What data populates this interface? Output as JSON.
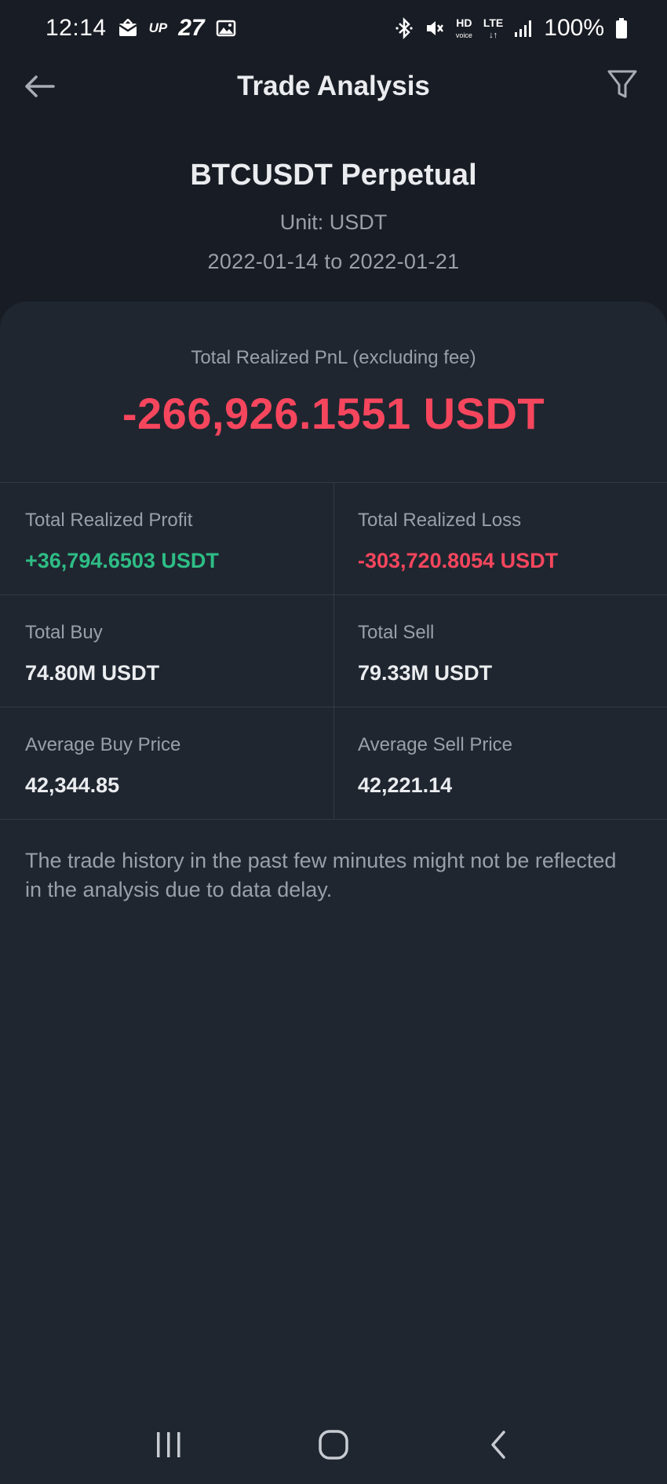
{
  "status_bar": {
    "time": "12:14",
    "up_label": "UP",
    "up_number": "27",
    "hd_label": "HD",
    "hd_sub": "voice",
    "lte_label": "LTE",
    "battery": "100%"
  },
  "header": {
    "title": "Trade Analysis",
    "symbol": "BTCUSDT Perpetual",
    "unit": "Unit: USDT",
    "date_range": "2022-01-14 to 2022-01-21"
  },
  "summary": {
    "pnl_label": "Total Realized PnL (excluding fee)",
    "pnl_value": "-266,926.1551 USDT"
  },
  "stats": [
    {
      "left_label": "Total Realized Profit",
      "left_value": "+36,794.6503 USDT",
      "right_label": "Total Realized Loss",
      "right_value": "-303,720.8054 USDT"
    },
    {
      "left_label": "Total Buy",
      "left_value": "74.80M USDT",
      "right_label": "Total Sell",
      "right_value": "79.33M USDT"
    },
    {
      "left_label": "Average Buy Price",
      "left_value": "42,344.85",
      "right_label": "Average Sell Price",
      "right_value": "42,221.14"
    }
  ],
  "note": "The trade history in the past few minutes might not be reflected in the analysis due to data delay.",
  "colors": {
    "background": "#1f2630",
    "header_background": "#181c24",
    "positive": "#2ebd85",
    "negative": "#f6465d",
    "secondary_text": "#9aa0a8"
  }
}
